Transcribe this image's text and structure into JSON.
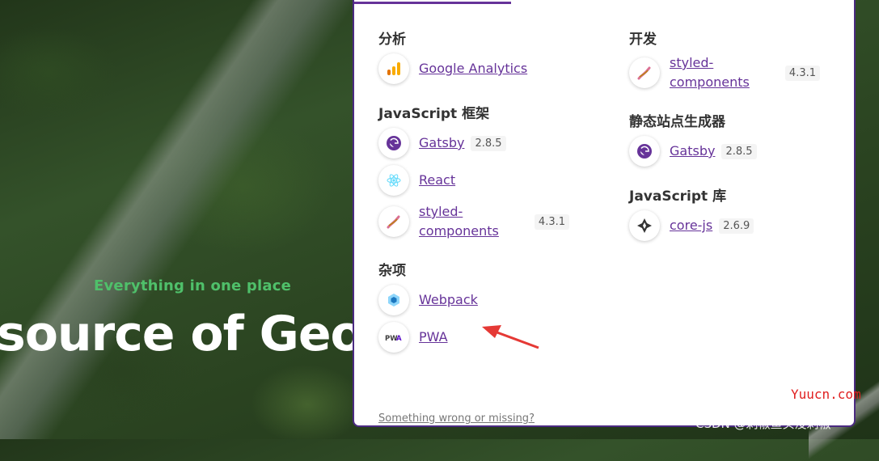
{
  "hero": {
    "tagline": "Everything in one place",
    "title": "source of Geos"
  },
  "panel": {
    "left_column": [
      {
        "title": "分析",
        "items": [
          {
            "name": "Google Analytics",
            "version": "",
            "icon": "google-analytics-icon"
          }
        ]
      },
      {
        "title": "JavaScript 框架",
        "items": [
          {
            "name": "Gatsby",
            "version": "2.8.5",
            "icon": "gatsby-icon"
          },
          {
            "name": "React",
            "version": "",
            "icon": "react-icon"
          },
          {
            "name": "styled-components",
            "version": "4.3.1",
            "icon": "styled-components-icon"
          }
        ]
      },
      {
        "title": "杂项",
        "items": [
          {
            "name": "Webpack",
            "version": "",
            "icon": "webpack-icon"
          },
          {
            "name": "PWA",
            "version": "",
            "icon": "pwa-icon"
          }
        ]
      }
    ],
    "right_column": [
      {
        "title": "开发",
        "items": [
          {
            "name": "styled-components",
            "version": "4.3.1",
            "icon": "styled-components-icon"
          }
        ]
      },
      {
        "title": "静态站点生成器",
        "items": [
          {
            "name": "Gatsby",
            "version": "2.8.5",
            "icon": "gatsby-icon"
          }
        ]
      },
      {
        "title": "JavaScript 库",
        "items": [
          {
            "name": "core-js",
            "version": "2.6.9",
            "icon": "core-js-icon"
          }
        ]
      }
    ],
    "footer_link": "Something wrong or missing?"
  },
  "watermarks": {
    "site": "Yuucn.com",
    "author": "CSDN @剁椒鱼头没剁椒"
  },
  "colors": {
    "accent": "#663399",
    "annotation_arrow": "#e53935",
    "tagline": "#4fc06a"
  }
}
